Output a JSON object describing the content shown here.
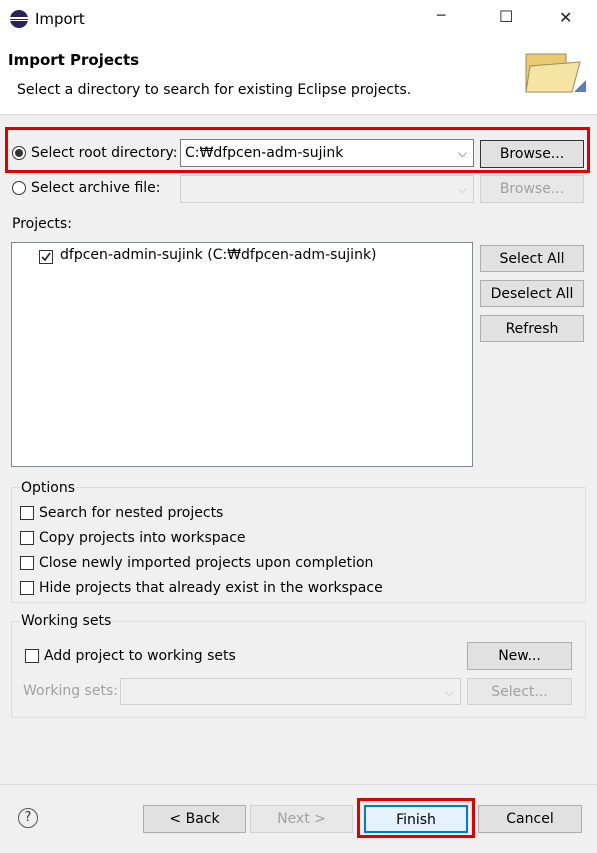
{
  "window": {
    "title": "Import",
    "controls": {
      "minimize": "─",
      "maximize": "☐",
      "close": "✕"
    }
  },
  "header": {
    "title": "Import Projects",
    "description": "Select a directory to search for existing Eclipse projects."
  },
  "source": {
    "root_radio_label": "Select root directory:",
    "root_path": "C:₩dfpcen-adm-sujink",
    "browse_root": "Browse...",
    "archive_radio_label": "Select archive file:",
    "archive_path": "",
    "browse_archive": "Browse..."
  },
  "projects": {
    "label": "Projects:",
    "items": [
      {
        "label": "dfpcen-admin-sujink (C:₩dfpcen-adm-sujink)",
        "checked": true
      }
    ],
    "select_all": "Select All",
    "deselect_all": "Deselect All",
    "refresh": "Refresh"
  },
  "options": {
    "legend": "Options",
    "items": [
      {
        "label": "Search for nested projects",
        "checked": false
      },
      {
        "label": "Copy projects into workspace",
        "checked": false
      },
      {
        "label": "Close newly imported projects upon completion",
        "checked": false
      },
      {
        "label": "Hide projects that already exist in the workspace",
        "checked": false
      }
    ]
  },
  "working_sets": {
    "legend": "Working sets",
    "add_label": "Add project to working sets",
    "new_button": "New...",
    "sets_label": "Working sets:",
    "select_button": "Select..."
  },
  "footer": {
    "help_icon": "?",
    "back": "< Back",
    "next": "Next >",
    "finish": "Finish",
    "cancel": "Cancel"
  },
  "colors": {
    "highlight": "#e00000",
    "accent": "#0078d7"
  }
}
